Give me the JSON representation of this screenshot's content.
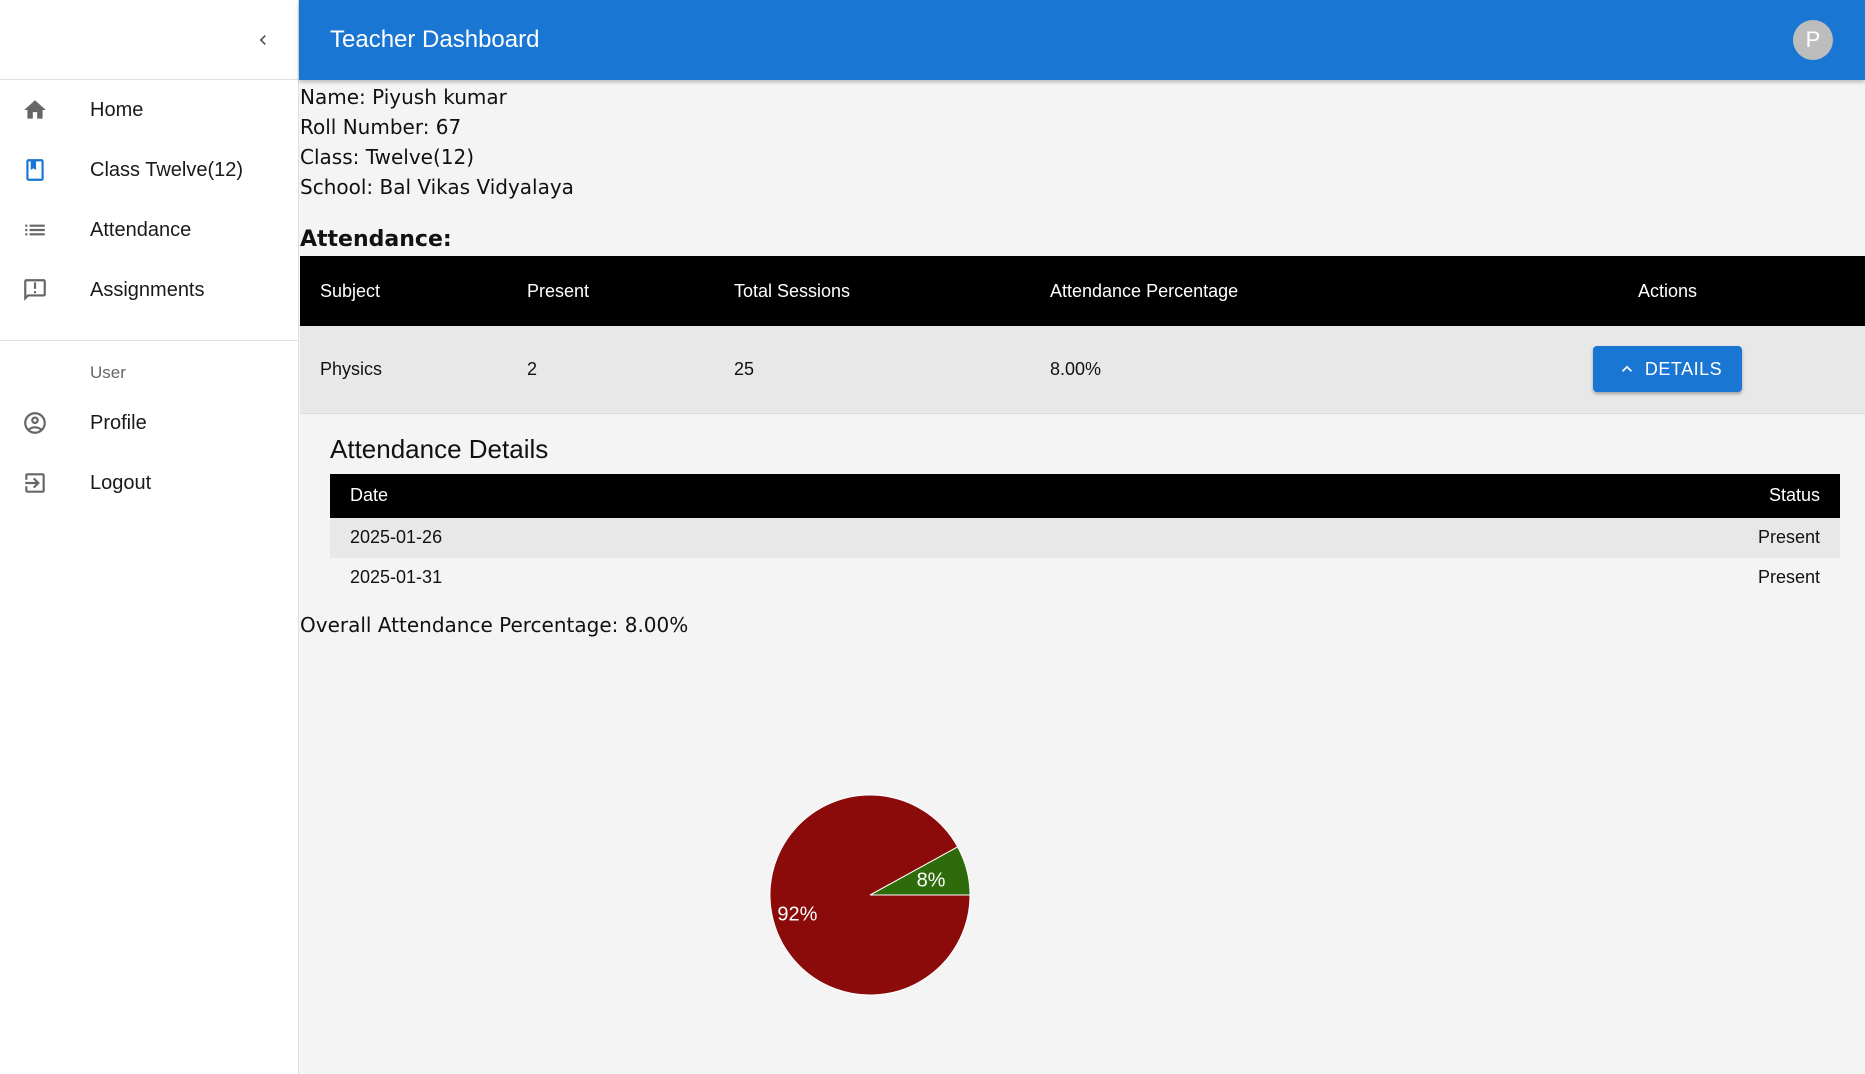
{
  "header": {
    "title": "Teacher Dashboard",
    "avatar_initial": "P"
  },
  "sidebar": {
    "collapse_icon": "chevron-left-icon",
    "items": [
      {
        "label": "Home",
        "icon": "home-icon"
      },
      {
        "label": "Class Twelve(12)",
        "icon": "bookmark-book-icon"
      },
      {
        "label": "Attendance",
        "icon": "list-icon"
      },
      {
        "label": "Assignments",
        "icon": "feedback-icon"
      }
    ],
    "section_label": "User",
    "user_items": [
      {
        "label": "Profile",
        "icon": "account-circle-icon"
      },
      {
        "label": "Logout",
        "icon": "logout-icon"
      }
    ]
  },
  "student": {
    "name": "Name: Piyush kumar",
    "roll": "Roll Number: 67",
    "class": "Class: Twelve(12)",
    "school": "School: Bal Vikas Vidyalaya"
  },
  "attendance": {
    "heading": "Attendance:",
    "columns": [
      "Subject",
      "Present",
      "Total Sessions",
      "Attendance Percentage",
      "Actions"
    ],
    "rows": [
      {
        "subject": "Physics",
        "present": "2",
        "total": "25",
        "percentage": "8.00%",
        "action_label": "DETAILS"
      }
    ]
  },
  "details": {
    "title": "Attendance Details",
    "columns": [
      "Date",
      "Status"
    ],
    "rows": [
      {
        "date": "2025-01-26",
        "status": "Present"
      },
      {
        "date": "2025-01-31",
        "status": "Present"
      }
    ]
  },
  "overall": "Overall Attendance Percentage: 8.00%",
  "colors": {
    "primary": "#1976d2",
    "present": "#2e6b0a",
    "absent": "#8b0a0a"
  },
  "chart_data": {
    "type": "pie",
    "title": "",
    "slices": [
      {
        "value": 8,
        "label": "8%",
        "color": "#2e6b0a"
      },
      {
        "value": 92,
        "label": "92%",
        "color": "#8b0a0a"
      }
    ]
  }
}
